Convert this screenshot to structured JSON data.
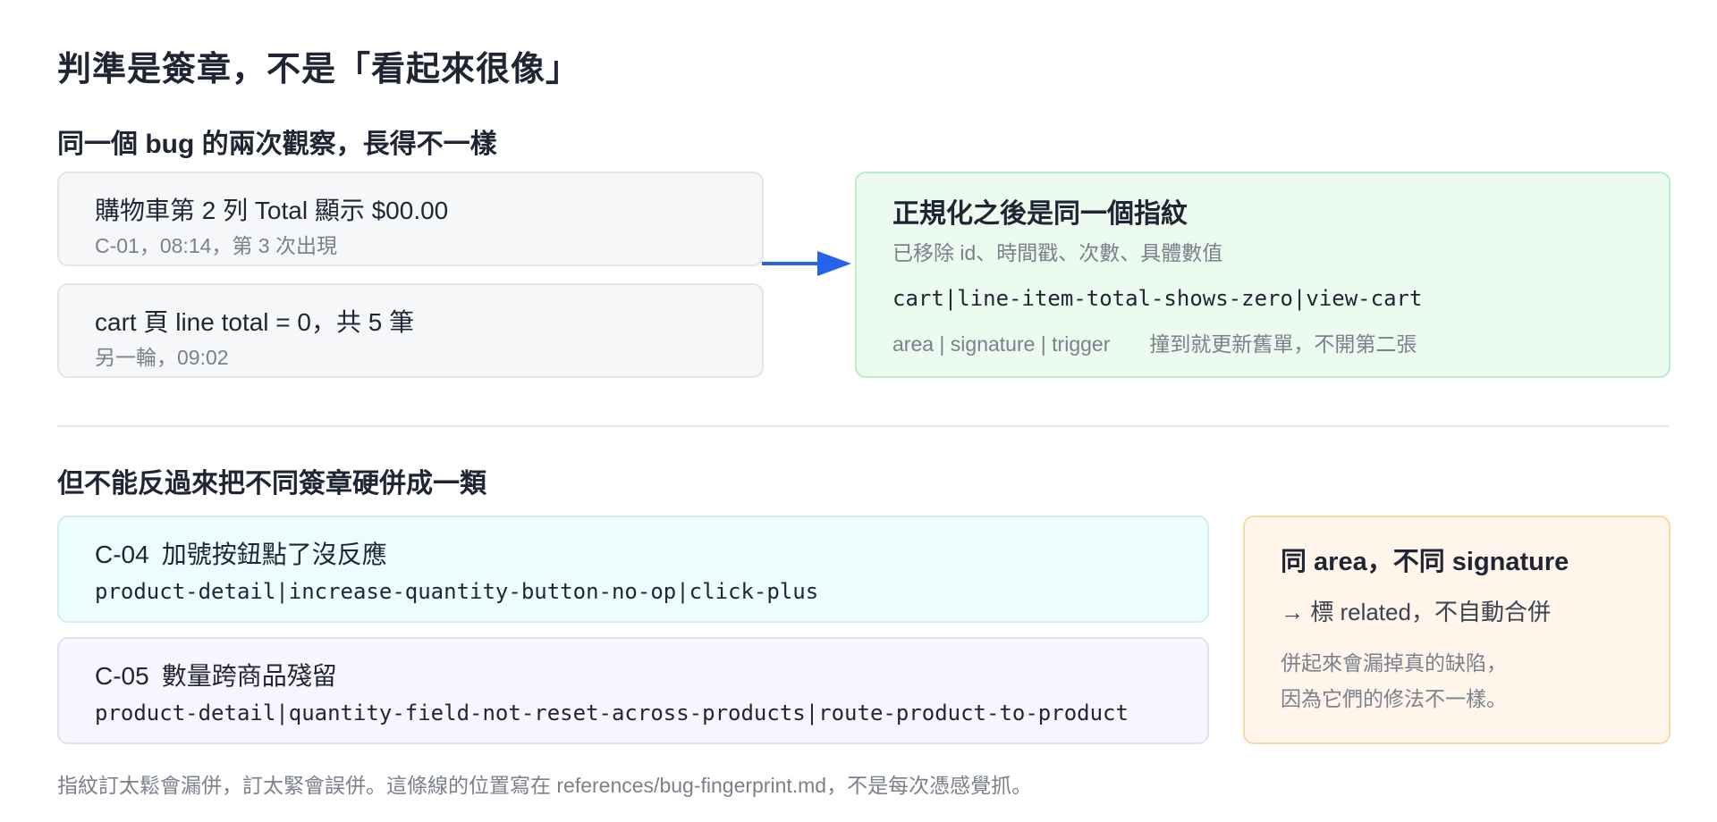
{
  "title": "判準是簽章，不是「看起來很像」",
  "section1": {
    "heading": "同一個 bug 的兩次觀察，長得不一樣",
    "observation1": {
      "main": "購物車第 2 列 Total 顯示 $00.00",
      "sub": "C-01，08:14，第 3 次出現"
    },
    "observation2": {
      "main": "cart 頁 line total = 0，共 5 筆",
      "sub": "另一輪，09:02"
    },
    "result": {
      "heading": "正規化之後是同一個指紋",
      "removed": "已移除 id、時間戳、次數、具體數值",
      "fingerprint": "cart|line-item-total-shows-zero|view-cart",
      "legend": "area | signature | trigger",
      "action": "撞到就更新舊單，不開第二張"
    }
  },
  "section2": {
    "heading": "但不能反過來把不同簽章硬併成一類",
    "case1": {
      "id": "C-04",
      "desc": "加號按鈕點了沒反應",
      "fingerprint": "product-detail|increase-quantity-button-no-op|click-plus"
    },
    "case2": {
      "id": "C-05",
      "desc": "數量跨商品殘留",
      "fingerprint": "product-detail|quantity-field-not-reset-across-products|route-product-to-product"
    },
    "note": {
      "heading": "同 area，不同 signature",
      "action": "→ 標 related，不自動合併",
      "line1": "併起來會漏掉真的缺陷，",
      "line2": "因為它們的修法不一樣。"
    }
  },
  "footer": "指紋訂太鬆會漏併，訂太緊會誤併。這條線的位置寫在 references/bug-fingerprint.md，不是每次憑感覺抓。",
  "colors": {
    "arrow": "#2563eb",
    "green_bg": "#ebfbef",
    "cyan_bg": "#ebfdfd",
    "lavender_bg": "#f8f5fe",
    "orange_bg": "#fff5ea"
  }
}
